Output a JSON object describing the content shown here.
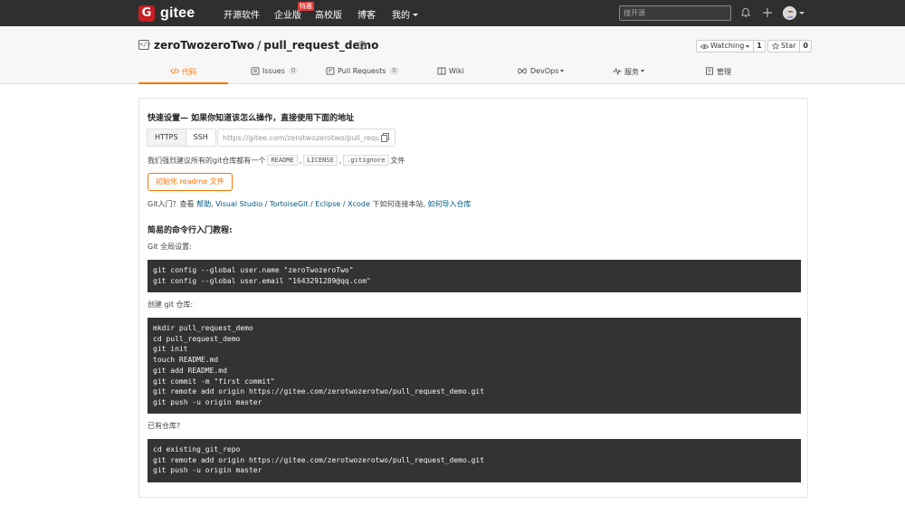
{
  "topbar": {
    "logo_text": "gitee",
    "nav": [
      "开源软件",
      "企业版",
      "高校版",
      "博客",
      "我的"
    ],
    "enterprise_badge": "特惠",
    "search_placeholder": "搜开源"
  },
  "repo": {
    "owner": "zeroTwozeroTwo",
    "separator": "/",
    "name": "pull_request_demo",
    "watch_label": "Watching",
    "watch_count": "1",
    "star_label": "Star",
    "star_count": "0"
  },
  "tabs": [
    {
      "label": "代码",
      "icon": "code-icon"
    },
    {
      "label": "Issues",
      "count": "0",
      "icon": "issues-icon"
    },
    {
      "label": "Pull Requests",
      "count": "0",
      "icon": "pull-request-icon"
    },
    {
      "label": "Wiki",
      "icon": "wiki-icon"
    },
    {
      "label": "DevOps",
      "icon": "devops-icon"
    },
    {
      "label": "服务",
      "icon": "service-icon"
    },
    {
      "label": "管理",
      "icon": "manage-icon"
    }
  ],
  "setup": {
    "title": "快速设置— 如果你知道该怎么操作，直接使用下面的地址",
    "proto_https": "HTTPS",
    "proto_ssh": "SSH",
    "url_value": "https://gitee.com/zerotwozerotwo/pull_request_demo.git",
    "recommend_prefix": "我们强烈建议所有的git仓库都有一个",
    "file_readme": "README",
    "file_license": "LICENSE",
    "file_gitignore": ".gitignore",
    "recommend_suffix": "文件",
    "comma1": ",",
    "comma2": ",",
    "init_button": "初始化 readme 文件",
    "help_prefix": "Git入门？查看",
    "help_link": "帮助",
    "help_tools": "Visual Studio / TortoiseGit / Eclipse / Xcode",
    "help_middle": "下如何连接本站,",
    "help_import": "如何导入仓库",
    "dot": ","
  },
  "tutorial": {
    "title": "简易的命令行入门教程:",
    "global_label": "Git 全局设置:",
    "global_code": [
      "git config --global user.name \"zeroTwozeroTwo\"",
      "git config --global user.email \"1643291289@qq.com\""
    ],
    "create_label": "创建 git 仓库:",
    "create_code": [
      "mkdir pull_request_demo",
      "cd pull_request_demo",
      "git init",
      "touch README.md",
      "git add README.md",
      "git commit -m \"first commit\"",
      "git remote add origin https://gitee.com/zerotwozerotwo/pull_request_demo.git",
      "git push -u origin master"
    ],
    "existing_label": "已有仓库?",
    "existing_code": [
      "cd existing_git_repo",
      "git remote add origin https://gitee.com/zerotwozerotwo/pull_request_demo.git",
      "git push -u origin master"
    ]
  }
}
